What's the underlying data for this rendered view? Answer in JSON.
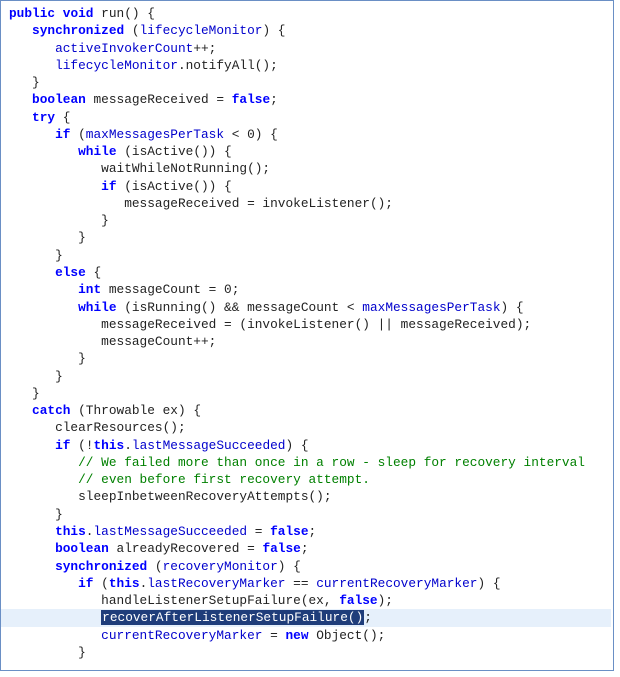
{
  "code": {
    "l1a": "public",
    "l1b": "void",
    "l1c": " run() {",
    "l2a": "synchronized",
    "l2b": " (",
    "l2c": "lifecycleMonitor",
    "l2d": ") {",
    "l3a": "activeInvokerCount",
    "l3b": "++;",
    "l4a": "lifecycleMonitor",
    "l4b": ".notifyAll();",
    "l5": "}",
    "l6a": "boolean",
    "l6b": " messageReceived = ",
    "l6c": "false",
    "l6d": ";",
    "l7a": "try",
    "l7b": " {",
    "l8a": "if",
    "l8b": " (",
    "l8c": "maxMessagesPerTask",
    "l8d": " < 0) {",
    "l9a": "while",
    "l9b": " (isActive()) {",
    "l10": "waitWhileNotRunning();",
    "l11a": "if",
    "l11b": " (isActive()) {",
    "l12": "messageReceived = invokeListener();",
    "l13": "}",
    "l14": "}",
    "l15": "}",
    "l16a": "else",
    "l16b": " {",
    "l17a": "int",
    "l17b": " messageCount = 0;",
    "l18a": "while",
    "l18b": " (isRunning() && messageCount < ",
    "l18c": "maxMessagesPerTask",
    "l18d": ") {",
    "l19": "messageReceived = (invokeListener() || messageReceived);",
    "l20": "messageCount++;",
    "l21": "}",
    "l22": "}",
    "l23": "}",
    "l24a": "catch",
    "l24b": " (Throwable ex) {",
    "l25": "clearResources();",
    "l26a": "if",
    "l26b": " (!",
    "l26c": "this",
    "l26d": ".",
    "l26e": "lastMessageSucceeded",
    "l26f": ") {",
    "l27": "// We failed more than once in a row - sleep for recovery interval",
    "l28": "// even before first recovery attempt.",
    "l29": "sleepInbetweenRecoveryAttempts();",
    "l30": "}",
    "l31a": "this",
    "l31b": ".",
    "l31c": "lastMessageSucceeded",
    "l31d": " = ",
    "l31e": "false",
    "l31f": ";",
    "l32a": "boolean",
    "l32b": " alreadyRecovered = ",
    "l32c": "false",
    "l32d": ";",
    "l33a": "synchronized",
    "l33b": " (",
    "l33c": "recoveryMonitor",
    "l33d": ") {",
    "l34a": "if",
    "l34b": " (",
    "l34c": "this",
    "l34d": ".",
    "l34e": "lastRecoveryMarker",
    "l34f": " == ",
    "l34g": "currentRecoveryMarker",
    "l34h": ") {",
    "l35a": "handleListenerSetupFailure(ex, ",
    "l35b": "false",
    "l35c": ");",
    "l36sel": "recoverAfterListenerSetupFailure()",
    "l36semi": ";",
    "l37a": "currentRecoveryMarker",
    "l37b": " = ",
    "l37c": "new",
    "l37d": " Object();",
    "l38": "}"
  }
}
